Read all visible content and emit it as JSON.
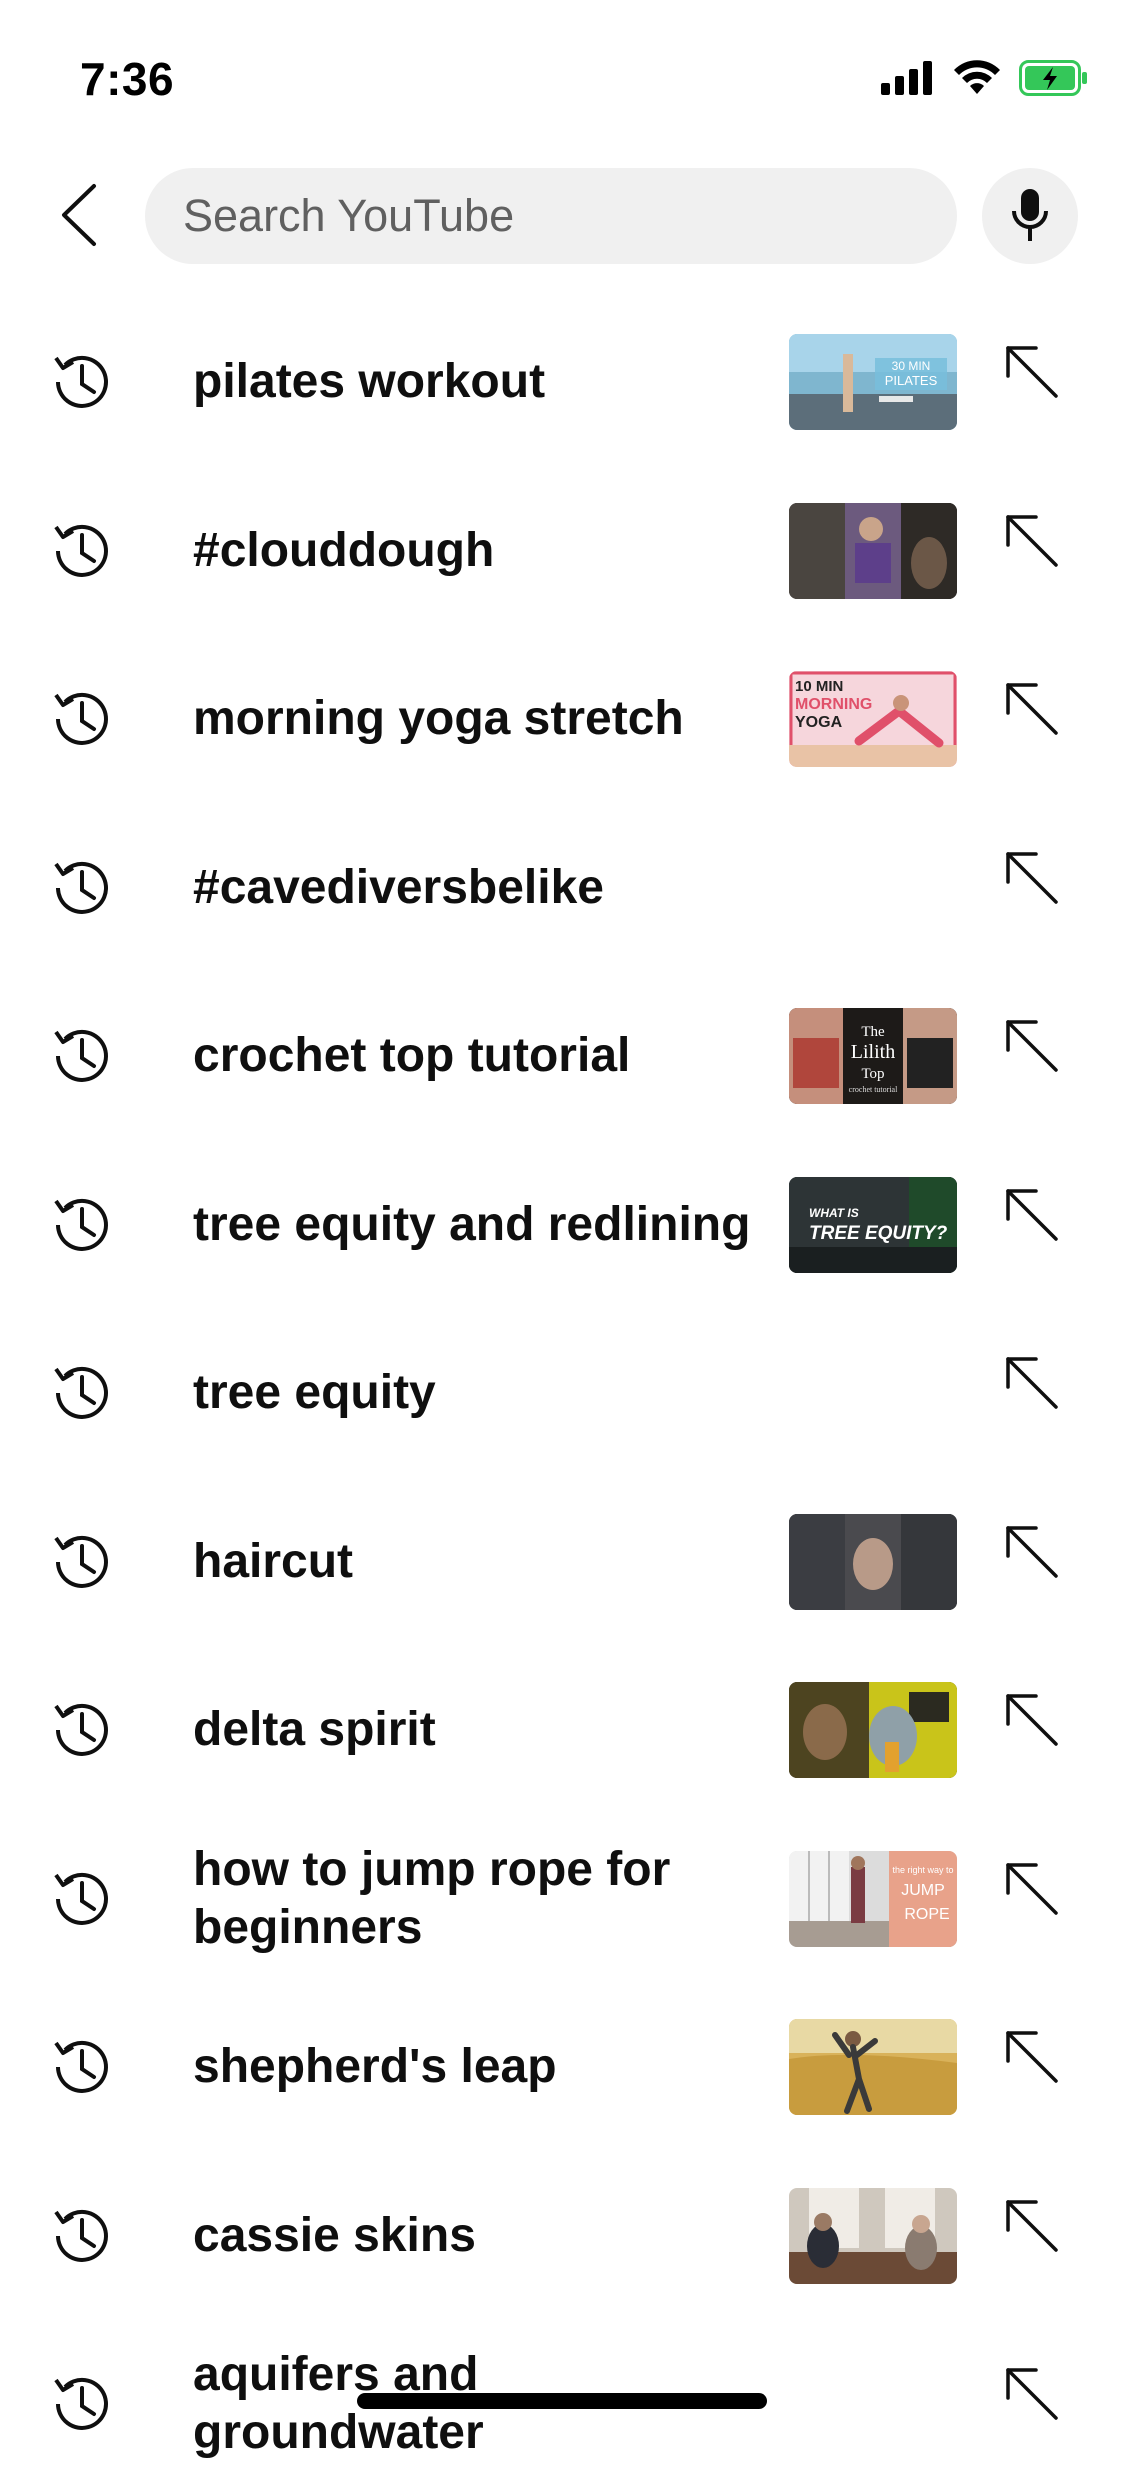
{
  "status_bar": {
    "time": "7:36"
  },
  "search": {
    "placeholder": "Search YouTube",
    "value": ""
  },
  "icons": {
    "back": "back-arrow-icon",
    "mic": "microphone-icon",
    "history": "history-icon",
    "fill": "arrow-up-left-icon"
  },
  "colors": {
    "text": "#0f0f0f",
    "search_bg": "#f0f0f0",
    "placeholder": "#606060",
    "battery_fill": "#34c759"
  },
  "suggestions": [
    {
      "text": "pilates workout",
      "thumb_text": "30 MIN PILATES",
      "has_thumb": true
    },
    {
      "text": "#clouddough",
      "thumb_text": "",
      "has_thumb": true
    },
    {
      "text": "morning yoga stretch",
      "thumb_text": "10 MIN MORNING YOGA",
      "has_thumb": true
    },
    {
      "text": "#cavediversbelike",
      "thumb_text": "",
      "has_thumb": false
    },
    {
      "text": "crochet top tutorial",
      "thumb_text": "The Lilith Top crochet tutorial",
      "has_thumb": true
    },
    {
      "text": "tree equity and redlining",
      "thumb_text": "WHAT IS TREE EQUITY?",
      "has_thumb": true
    },
    {
      "text": "tree equity",
      "thumb_text": "",
      "has_thumb": false
    },
    {
      "text": "haircut",
      "thumb_text": "",
      "has_thumb": true
    },
    {
      "text": "delta spirit",
      "thumb_text": "",
      "has_thumb": true
    },
    {
      "text": "how to jump rope for beginners",
      "thumb_text": "JUMP ROPE",
      "has_thumb": true
    },
    {
      "text": "shepherd's leap",
      "thumb_text": "",
      "has_thumb": true
    },
    {
      "text": "cassie skins",
      "thumb_text": "",
      "has_thumb": true
    },
    {
      "text": "aquifers and groundwater",
      "thumb_text": "",
      "has_thumb": false
    }
  ]
}
